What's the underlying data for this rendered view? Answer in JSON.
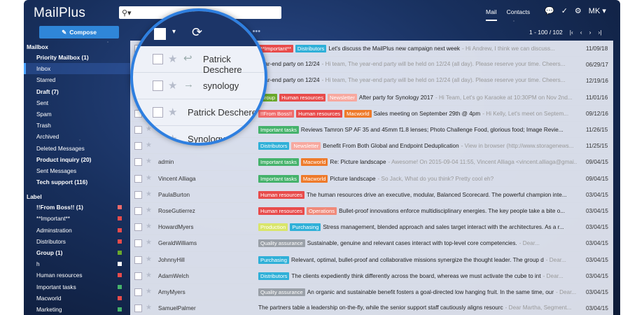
{
  "app": {
    "logo": "MailPlus"
  },
  "search": {
    "icon": "search-icon"
  },
  "topnav": {
    "mail": "Mail",
    "contacts": "Contacts",
    "user": "MK"
  },
  "toolbar": {
    "compose": "Compose",
    "pager": "1 - 100 / 102"
  },
  "sidebar": {
    "mailbox_label": "Mailbox",
    "items": [
      {
        "label": "Priority Mailbox (1)",
        "bold": true
      },
      {
        "label": "Inbox",
        "selected": true
      },
      {
        "label": "Starred"
      },
      {
        "label": "Draft (7)",
        "bold": true
      },
      {
        "label": "Sent"
      },
      {
        "label": "Spam"
      },
      {
        "label": "Trash"
      },
      {
        "label": "Archived"
      },
      {
        "label": "Deleted Messages"
      },
      {
        "label": "Product inquiry (20)",
        "bold": true
      },
      {
        "label": "Sent Messages"
      },
      {
        "label": "Tech support (116)",
        "bold": true
      }
    ],
    "label_header": "Label",
    "labels": [
      {
        "label": "!!From Boss!! (1)",
        "bold": true,
        "color": "#f06a6a"
      },
      {
        "label": "**Important**",
        "color": "#e84b4b"
      },
      {
        "label": "Adminstration",
        "color": "#e84b4b"
      },
      {
        "label": "Distributors",
        "color": "#e84b4b"
      },
      {
        "label": "Group (1)",
        "bold": true,
        "color": "#6aa82c"
      },
      {
        "label": "h",
        "color": "#ffffff"
      },
      {
        "label": "Human resources",
        "color": "#e84b4b"
      },
      {
        "label": "Important tasks",
        "color": "#45b26b"
      },
      {
        "label": "Macworld",
        "color": "#e84b4b"
      },
      {
        "label": "Marketing",
        "color": "#45b26b"
      }
    ]
  },
  "magnifier": {
    "rows": [
      "Patrick Deschere",
      "synology",
      "Patrick Deschere",
      "Synology"
    ]
  },
  "emails": [
    {
      "sender": "",
      "tags": [
        [
          "**Important**",
          "#e84b4b"
        ],
        [
          "Distributors",
          "#2fb0d8"
        ]
      ],
      "subject": "Let's discuss the MailPlus new campaign next week",
      "preview": "- Hi Andrew, I think we can discuss...",
      "date": "11/09/18"
    },
    {
      "sender": "",
      "tags": [],
      "subject": "Year-end party on 12/24",
      "preview": "- Hi team, The year-end party will be held on 12/24 (all day). Please reserve your time. Cheers...",
      "date": "06/29/17"
    },
    {
      "sender": "",
      "tags": [],
      "subject": "Year-end party on 12/24",
      "preview": "- Hi team, The year-end party will be held on 12/24 (all day). Please reserve your time. Cheers...",
      "date": "12/19/16"
    },
    {
      "sender": "",
      "tags": [
        [
          "Group",
          "#6aa82c"
        ],
        [
          "Human resources",
          "#e84b4b"
        ],
        [
          "Newsletter",
          "#f7a9a0"
        ]
      ],
      "subject": "After party for Synology 2017",
      "preview": "- Hi Team, Let's go Karaoke at 10:30PM on Nov 2nd...",
      "date": "11/01/16"
    },
    {
      "sender": "",
      "tags": [
        [
          "!!From Boss!!",
          "#f06a6a"
        ],
        [
          "Human resources",
          "#e84b4b"
        ],
        [
          "Macworld",
          "#ee7a2a"
        ]
      ],
      "subject": "Sales meeting on September 29th @ 4pm",
      "preview": "- Hi Kelly, Let's meet on Septem...",
      "date": "09/12/16"
    },
    {
      "sender": "",
      "tags": [
        [
          "Important tasks",
          "#45b26b"
        ]
      ],
      "subject": "Reviews Tamron SP AF 35 and 45mm f1.8 lenses; Photo Challenge Food, glorious food; Image Revie...",
      "preview": "",
      "date": "11/26/15"
    },
    {
      "sender": "",
      "tags": [
        [
          "Distributors",
          "#2fb0d8"
        ],
        [
          "Newsletter",
          "#f7a9a0"
        ]
      ],
      "subject": "Benefit From Both Global and Endpoint Deduplication",
      "preview": "- View in browser (http://www.storagenews...",
      "date": "11/25/15"
    },
    {
      "sender": "admin",
      "tags": [
        [
          "Important tasks",
          "#45b26b"
        ],
        [
          "Macworld",
          "#ee7a2a"
        ]
      ],
      "subject": "Re: Picture landscape",
      "preview": "- Awesome! On 2015-09-04 11:55, Vincent Alliaga <vincent.alliaga@gmai...",
      "date": "09/04/15"
    },
    {
      "sender": "Vincent Alliaga",
      "tags": [
        [
          "Important tasks",
          "#45b26b"
        ],
        [
          "Macworld",
          "#ee7a2a"
        ]
      ],
      "subject": "Picture landscape",
      "preview": "- So Jack, What do you think? Pretty cool eh?",
      "date": "09/04/15"
    },
    {
      "sender": "PaulaBurton",
      "tags": [
        [
          "Human resources",
          "#e84b4b"
        ]
      ],
      "subject": "The human resources drive an executive, modular, Balanced Scorecard. The powerful champion inte...",
      "preview": "",
      "date": "03/04/15"
    },
    {
      "sender": "RoseGutierrez",
      "tags": [
        [
          "Human resources",
          "#e84b4b"
        ],
        [
          "Operations",
          "#f08a7a"
        ]
      ],
      "subject": "Bullet-proof innovations enforce multidisciplinary energies. The key people take a bite o...",
      "preview": "",
      "date": "03/04/15"
    },
    {
      "sender": "HowardMyers",
      "tags": [
        [
          "Production",
          "#d9e56a"
        ],
        [
          "Purchasing",
          "#2fb0d8"
        ]
      ],
      "subject": "Stress management, blended approach and sales target interact with the architectures. As a r...",
      "preview": "",
      "date": "03/04/15"
    },
    {
      "sender": "GeraldWilliams",
      "tags": [
        [
          "Quality assurance",
          "#9aa0a8"
        ]
      ],
      "subject": "Sustainable, genuine and relevant cases interact with top-level core competencies.",
      "preview": "- Dear...",
      "date": "03/04/15"
    },
    {
      "sender": "JohnnyHill",
      "tags": [
        [
          "Purchasing",
          "#2fb0d8"
        ]
      ],
      "subject": "Relevant, optimal, bullet-proof and collaborative missions synergize the thought leader. The group d",
      "preview": "- Dear...",
      "date": "03/04/15"
    },
    {
      "sender": "AdamWelch",
      "tags": [
        [
          "Distributors",
          "#2fb0d8"
        ]
      ],
      "subject": "The clients expediently think differently across the board, whereas we must activate the cube to int",
      "preview": "- Dear...",
      "date": "03/04/15"
    },
    {
      "sender": "AmyMyers",
      "tags": [
        [
          "Quality assurance",
          "#9aa0a8"
        ]
      ],
      "subject": "An organic and sustainable benefit fosters a goal-directed low hanging fruit. In the same time, our",
      "preview": "- Dear...",
      "date": "03/04/15"
    },
    {
      "sender": "SamuelPalmer",
      "tags": [],
      "subject": "The partners table a leadership on-the-fly, while the senior support staff cautiously aligns resourc",
      "preview": "- Dear Martha, Segment...",
      "date": "03/04/15"
    }
  ]
}
